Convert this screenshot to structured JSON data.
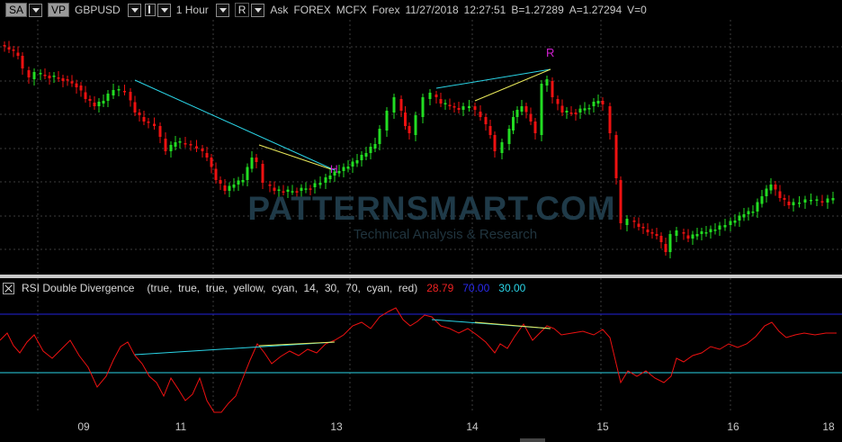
{
  "toolbar": {
    "layout_button": "SA",
    "vp_button": "VP",
    "symbol": "GBPUSD",
    "interval": "1 Hour",
    "chart_mode": "R",
    "quote_side": "Ask",
    "market": "FOREX",
    "feed": "MCFX",
    "asset_class": "Forex",
    "date": "11/27/2018",
    "time": "12:27:51",
    "bid": "B=1.27289",
    "ask": "A=1.27294",
    "volume": "V=0"
  },
  "watermark": {
    "title": "PATTERNSMART.COM",
    "subtitle": "Technical Analysis & Research"
  },
  "price_chart": {
    "pattern_labels": [
      "R",
      "H"
    ],
    "colors": {
      "up": "#22dd22",
      "down": "#ee1111",
      "trend_cyan": "#2ad4e6",
      "trend_yellow": "#e8e85a",
      "label": "#d020d0",
      "grid": "#4a4a4a"
    }
  },
  "rsi": {
    "name": "RSI Double Divergence",
    "params": "(true,  true,  true,  yellow,  cyan,  14,  30,  70,  cyan,  red)",
    "value": "28.79",
    "upper": "70.00",
    "lower": "30.00",
    "colors": {
      "line": "#ee1111",
      "upper_band": "#2222dd",
      "lower_band": "#2ad4e6",
      "value": "#ee2222"
    }
  },
  "x_axis": {
    "labels": [
      "09",
      "11",
      "13",
      "14",
      "15",
      "16",
      "18"
    ]
  }
}
